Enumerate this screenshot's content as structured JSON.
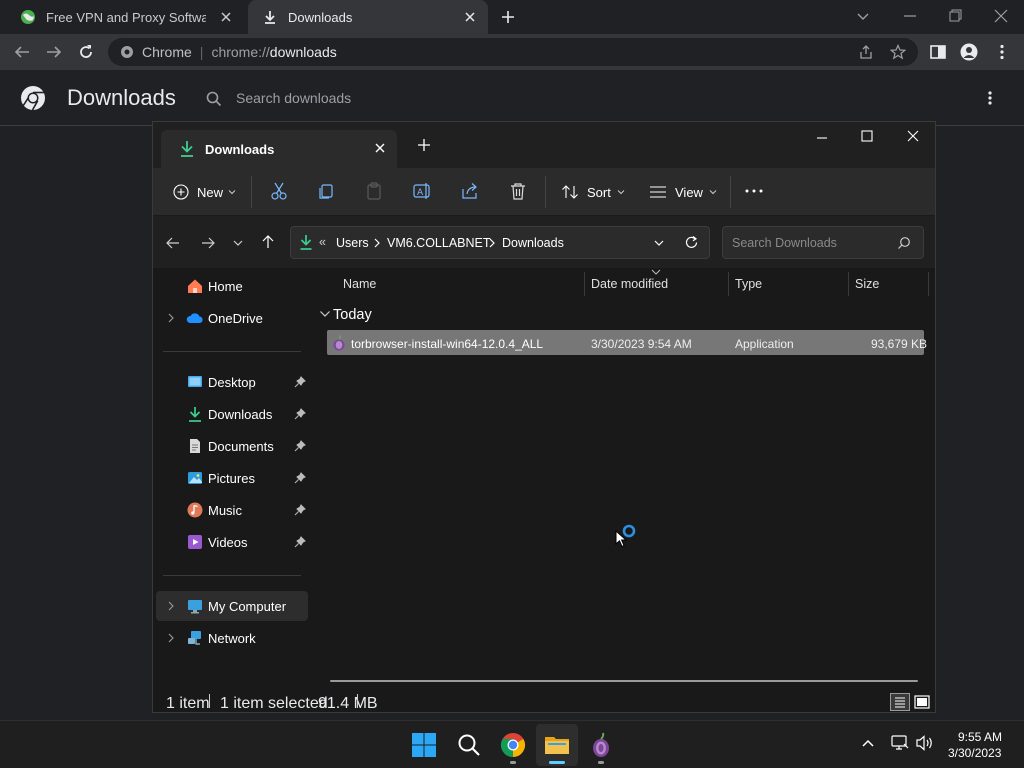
{
  "browser": {
    "tabs": [
      {
        "label": "Free VPN and Proxy Software - D",
        "active": false
      },
      {
        "label": "Downloads",
        "active": true
      }
    ],
    "omnibox": {
      "site_label": "Chrome",
      "separator": "|",
      "scheme": "chrome://",
      "path": "downloads"
    }
  },
  "downloads_page": {
    "title": "Downloads",
    "search_placeholder": "Search downloads"
  },
  "explorer": {
    "tab_label": "Downloads",
    "commands": {
      "new": "New",
      "sort": "Sort",
      "view": "View"
    },
    "address": {
      "overflow": "«",
      "crumbs": [
        "Users",
        "VM6.COLLABNET",
        "Downloads"
      ]
    },
    "search_placeholder": "Search Downloads",
    "nav": {
      "home": "Home",
      "onedrive": "OneDrive",
      "desktop": "Desktop",
      "downloads": "Downloads",
      "documents": "Documents",
      "pictures": "Pictures",
      "music": "Music",
      "videos": "Videos",
      "my_computer": "My Computer",
      "network": "Network"
    },
    "columns": {
      "name": "Name",
      "date": "Date modified",
      "type": "Type",
      "size": "Size"
    },
    "group_label": "Today",
    "files": [
      {
        "name": "torbrowser-install-win64-12.0.4_ALL",
        "date": "3/30/2023 9:54 AM",
        "type": "Application",
        "size": "93,679 KB"
      }
    ],
    "status": {
      "count": "1 item",
      "selected": "1 item selected",
      "size": "91.4 MB"
    }
  },
  "taskbar": {
    "time": "9:55 AM",
    "date": "3/30/2023"
  },
  "colors": {
    "accent": "#60cdff",
    "folder": "#f2c14e",
    "selection": "#777777"
  }
}
